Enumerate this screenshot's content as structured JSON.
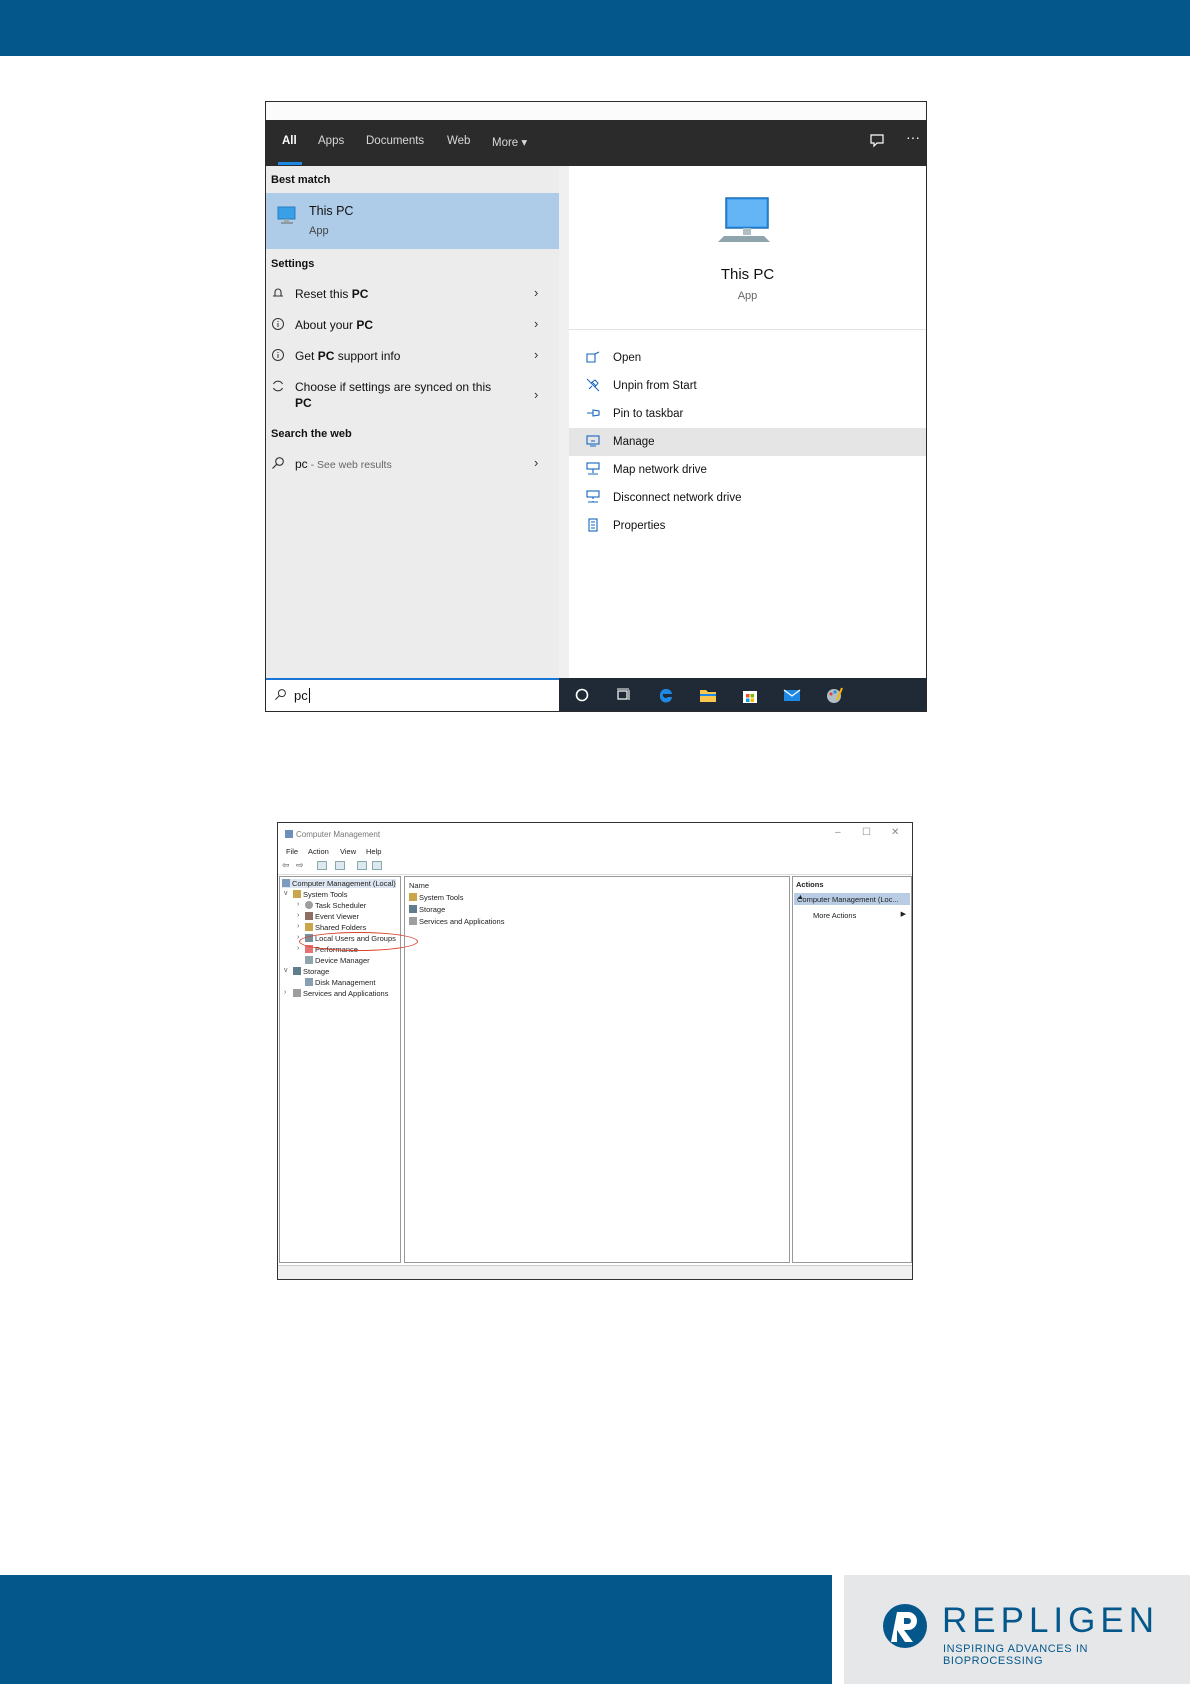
{
  "brand": {
    "logo_word": "REPLIGEN",
    "tagline": "INSPIRING ADVANCES IN BIOPROCESSING",
    "color": "#04578b"
  },
  "search_panel": {
    "tabs": [
      "All",
      "Apps",
      "Documents",
      "Web",
      "More"
    ],
    "active_tab": "All",
    "best_match_heading": "Best match",
    "best_match": {
      "title": "This PC",
      "subtitle": "App",
      "icon": "computer-icon"
    },
    "settings_heading": "Settings",
    "settings": [
      {
        "label_pre": "Reset this ",
        "label_bold": "PC",
        "icon": "reset-icon"
      },
      {
        "label_pre": "About your ",
        "label_bold": "PC",
        "icon": "info-icon"
      },
      {
        "label_pre": "Get ",
        "label_bold": "PC",
        "label_post": " support info",
        "icon": "info-icon"
      },
      {
        "label_pre": "Choose if settings are synced on this",
        "label_bold": "PC",
        "icon": "sync-icon"
      }
    ],
    "web_heading": "Search the web",
    "web_result": {
      "query": "pc",
      "hint": " - See web results",
      "icon": "search-icon"
    },
    "detail": {
      "title": "This PC",
      "subtitle": "App",
      "actions": [
        {
          "label": "Open",
          "icon": "open-icon"
        },
        {
          "label": "Unpin from Start",
          "icon": "unpin-icon"
        },
        {
          "label": "Pin to taskbar",
          "icon": "pin-icon"
        },
        {
          "label": "Manage",
          "icon": "manage-icon",
          "highlighted": true
        },
        {
          "label": "Map network drive",
          "icon": "map-drive-icon"
        },
        {
          "label": "Disconnect network drive",
          "icon": "disconnect-drive-icon"
        },
        {
          "label": "Properties",
          "icon": "properties-icon"
        }
      ]
    },
    "search_value": "pc",
    "taskbar_icons": [
      "cortana-icon",
      "task-view-icon",
      "edge-icon",
      "file-explorer-icon",
      "store-icon",
      "mail-icon",
      "paint-icon"
    ]
  },
  "computer_management": {
    "window_title": "Computer Management",
    "menu": [
      "File",
      "Action",
      "View",
      "Help"
    ],
    "tree": {
      "root": "Computer Management (Local)",
      "system_tools": "System Tools",
      "task_scheduler": "Task Scheduler",
      "event_viewer": "Event Viewer",
      "shared_folders": "Shared Folders",
      "local_users": "Local Users and Groups",
      "performance": "Performance",
      "device_manager": "Device Manager",
      "storage": "Storage",
      "disk_management": "Disk Management",
      "services": "Services and Applications"
    },
    "list": {
      "column": "Name",
      "items": [
        "System Tools",
        "Storage",
        "Services and Applications"
      ]
    },
    "actions": {
      "heading": "Actions",
      "selected": "Computer Management (Loc...",
      "more": "More Actions"
    },
    "highlight_color": "#d9412b"
  }
}
